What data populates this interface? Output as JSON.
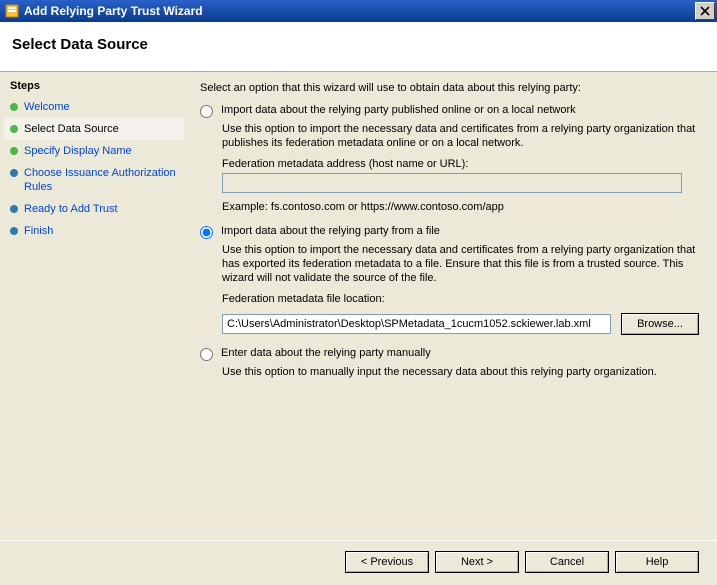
{
  "window": {
    "title": "Add Relying Party Trust Wizard"
  },
  "header": {
    "page_title": "Select Data Source"
  },
  "sidebar": {
    "heading": "Steps",
    "items": [
      {
        "label": "Welcome"
      },
      {
        "label": "Select Data Source"
      },
      {
        "label": "Specify Display Name"
      },
      {
        "label": "Choose Issuance Authorization Rules"
      },
      {
        "label": "Ready to Add Trust"
      },
      {
        "label": "Finish"
      }
    ]
  },
  "main": {
    "intro": "Select an option that this wizard will use to obtain data about this relying party:",
    "option_online": {
      "label": "Import data about the relying party published online or on a local network",
      "desc": "Use this option to import the necessary data and certificates from a relying party organization that publishes its federation metadata online or on a local network.",
      "url_label": "Federation metadata address (host name or URL):",
      "url_value": "",
      "example": "Example: fs.contoso.com or https://www.contoso.com/app"
    },
    "option_file": {
      "label": "Import data about the relying party from a file",
      "desc": "Use this option to import the necessary data and certificates from a relying party organization that has exported its federation metadata to a file. Ensure that this file is from a trusted source.  This wizard will not validate the source of the file.",
      "file_label": "Federation metadata file location:",
      "file_value": "C:\\Users\\Administrator\\Desktop\\SPMetadata_1cucm1052.sckiewer.lab.xml",
      "browse_label": "Browse..."
    },
    "option_manual": {
      "label": "Enter data about the relying party manually",
      "desc": "Use this option to manually input the necessary data about this relying party organization."
    }
  },
  "footer": {
    "previous": "< Previous",
    "next": "Next >",
    "cancel": "Cancel",
    "help": "Help"
  }
}
